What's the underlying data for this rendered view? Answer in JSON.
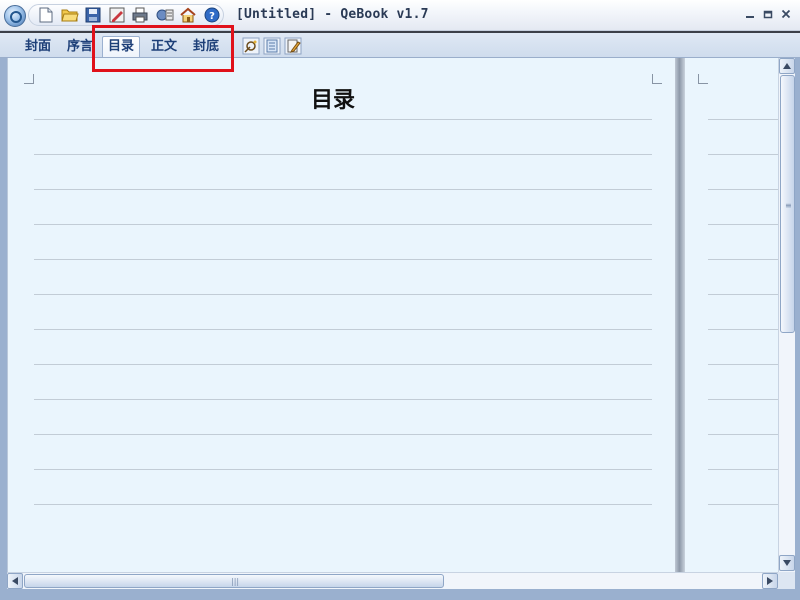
{
  "window": {
    "title": "[Untitled] - QeBook v1.7"
  },
  "quick_access": {
    "buttons": [
      {
        "name": "new-icon"
      },
      {
        "name": "open-folder-icon"
      },
      {
        "name": "save-icon"
      },
      {
        "name": "save-as-icon"
      },
      {
        "name": "print-icon"
      },
      {
        "name": "compile-icon"
      },
      {
        "name": "home-icon"
      },
      {
        "name": "help-icon"
      }
    ]
  },
  "window_controls": {
    "minimize": "minimize-icon",
    "restore": "restore-icon",
    "close": "close-icon"
  },
  "tabs": [
    {
      "label": "封面",
      "active": false
    },
    {
      "label": "序言",
      "active": false
    },
    {
      "label": "目录",
      "active": true
    },
    {
      "label": "正文",
      "active": false
    },
    {
      "label": "封底",
      "active": false
    }
  ],
  "toolbar_icons": [
    "settings-wand-icon",
    "list-page-icon",
    "edit-doc-icon"
  ],
  "document": {
    "page_title": "目录",
    "line_count": 12
  },
  "colors": {
    "page_background": "#eaf5fd",
    "highlight_box": "#e0111a",
    "tab_text": "#1d3f78"
  }
}
